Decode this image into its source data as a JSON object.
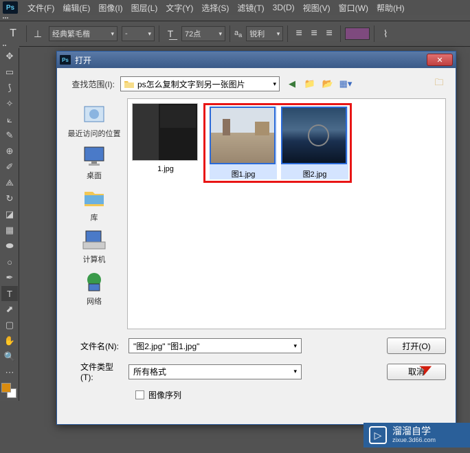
{
  "menubar": {
    "items": [
      "文件(F)",
      "编辑(E)",
      "图像(I)",
      "图层(L)",
      "文字(Y)",
      "选择(S)",
      "滤镜(T)",
      "3D(D)",
      "视图(V)",
      "窗口(W)",
      "帮助(H)"
    ]
  },
  "optbar": {
    "font_family": "经典繁毛楷",
    "font_style": "-",
    "font_size": "72点",
    "aa_label": "a_a",
    "aa_mode": "锐利",
    "color": "#7e4a7e"
  },
  "toolbox": {
    "tools": [
      "move",
      "marquee",
      "lasso",
      "wand",
      "crop",
      "eyedrop",
      "heal",
      "brush",
      "stamp",
      "history",
      "eraser",
      "gradient",
      "blur",
      "dodge",
      "pen",
      "type",
      "path",
      "shape",
      "hand",
      "zoom"
    ]
  },
  "dialog": {
    "title": "打开",
    "lookin_label": "查找范围(I):",
    "lookin_path": "ps怎么复制文字到另一张图片",
    "places": [
      {
        "label": "最近访问的位置"
      },
      {
        "label": "桌面"
      },
      {
        "label": "库"
      },
      {
        "label": "计算机"
      },
      {
        "label": "网络"
      }
    ],
    "files": [
      {
        "name": "1.jpg",
        "selected": false
      },
      {
        "name": "图1.jpg",
        "selected": true
      },
      {
        "name": "图2.jpg",
        "selected": true
      }
    ],
    "filename_label": "文件名(N):",
    "filename_value": "\"图2.jpg\" \"图1.jpg\"",
    "filetype_label": "文件类型(T):",
    "filetype_value": "所有格式",
    "open_btn": "打开(O)",
    "cancel_btn": "取消",
    "image_seq": "图像序列"
  },
  "watermark": {
    "title": "溜溜自学",
    "sub": "zixue.3d66.com"
  }
}
